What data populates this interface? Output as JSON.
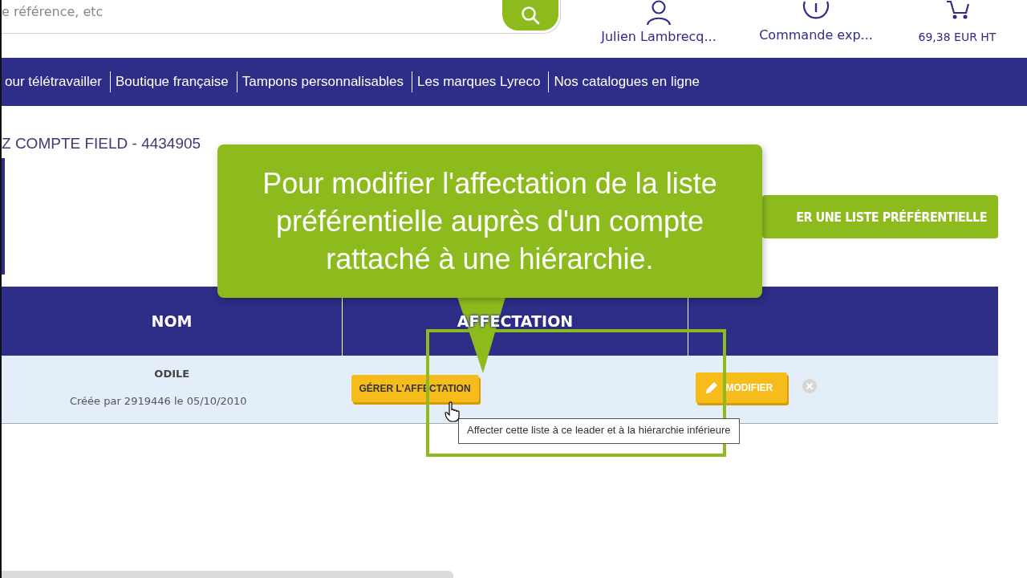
{
  "header": {
    "search": {
      "placeholder": "e référence, etc"
    },
    "account": {
      "label": "Julien Lambrecq..."
    },
    "order": {
      "label": "Commande exp..."
    },
    "cart": {
      "label": "69,38 EUR HT"
    }
  },
  "nav": {
    "items": [
      "our télétravailler",
      "Boutique française",
      "Tampons personnalisables",
      "Les marques Lyreco",
      "Nos catalogues en ligne"
    ]
  },
  "page_title": "Z COMPTE FIELD - 4434905",
  "create_button": "ER UNE LISTE PRÉFÉRENTIELLE",
  "table": {
    "columns": [
      "NOM",
      "AFFECTATION"
    ],
    "rows": [
      {
        "name": "ODILE",
        "created": "Créée par 2919446 le 05/10/2010",
        "assign_button": "GÉRER L'AFFECTATION",
        "edit_button": "MODIFIER"
      }
    ]
  },
  "tooltip": "Affecter cette liste à ce leader et à la hiérarchie inférieure",
  "callout": {
    "text": "Pour modifier l'affectation de la liste préférentielle auprès d'un compte rattaché à une hiérarchie."
  }
}
